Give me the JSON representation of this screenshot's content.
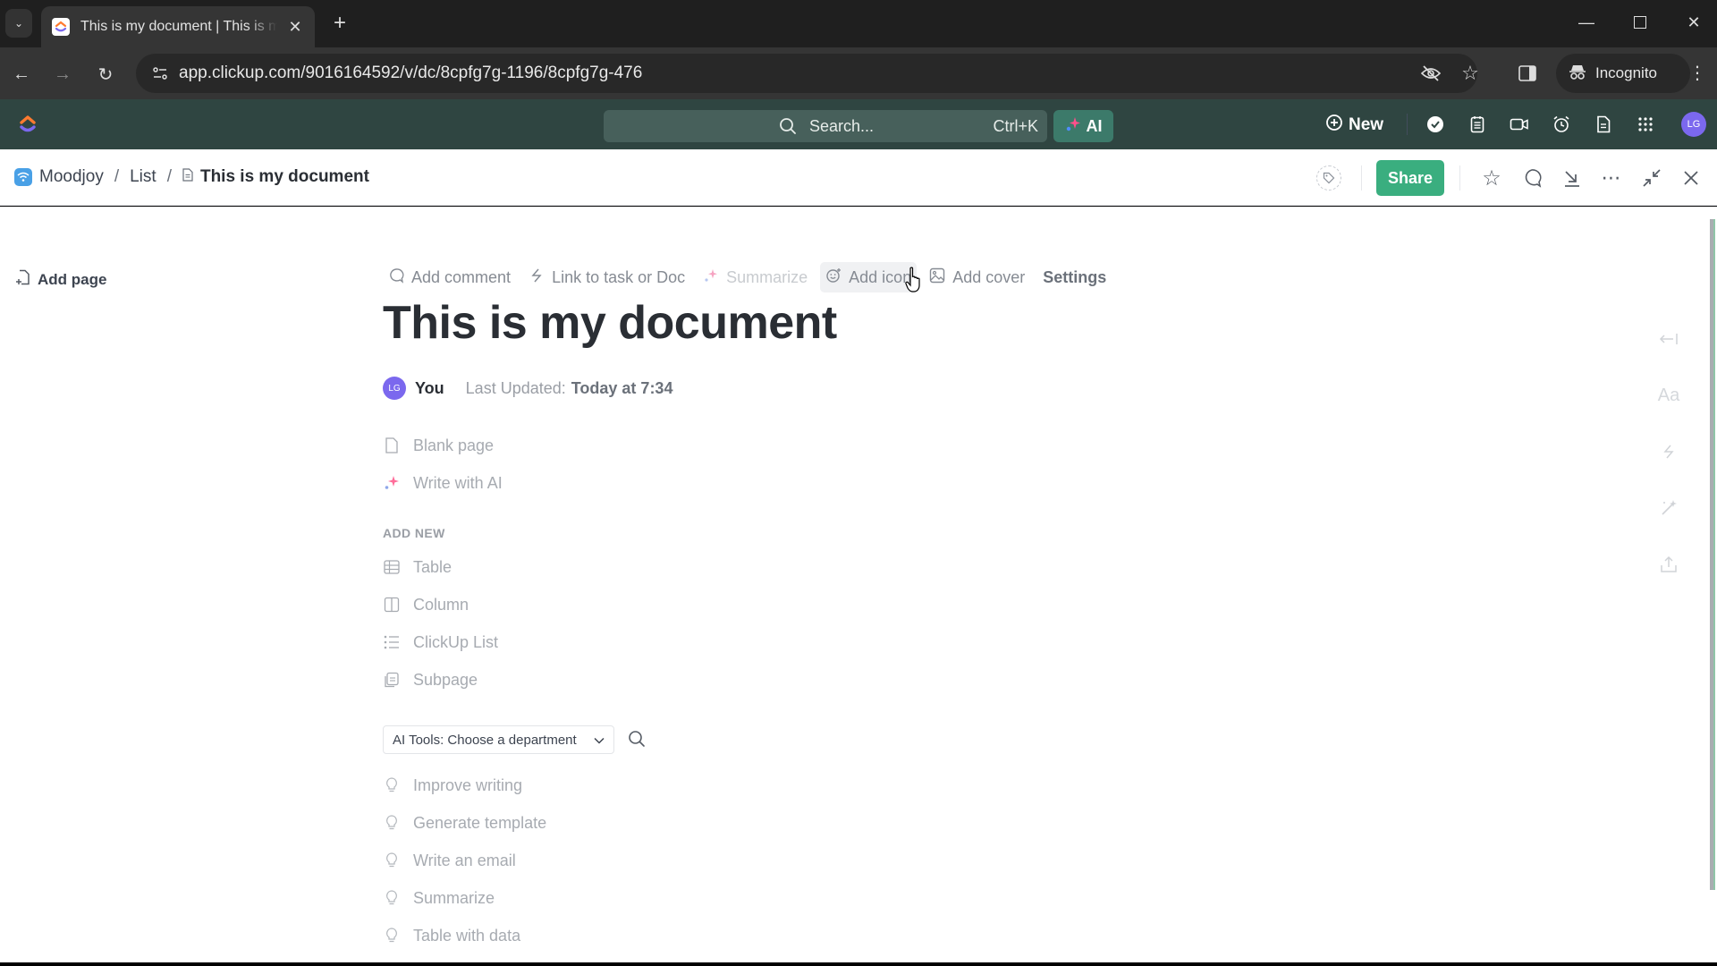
{
  "browser": {
    "tab_title": "This is my document | This is my document",
    "url": "app.clickup.com/9016164592/v/dc/8cpfg7g-1196/8cpfg7g-476",
    "incognito_label": "Incognito",
    "new_tab_label": "+",
    "tab_close": "✕"
  },
  "topbar": {
    "search_placeholder": "Search...",
    "search_shortcut": "Ctrl+K",
    "ai_label": "AI",
    "new_label": "New",
    "avatar_initials": "LG",
    "icons": [
      "check-circle-icon",
      "notepad-icon",
      "video-icon",
      "alarm-clock-icon",
      "document-icon",
      "apps-grid-icon"
    ]
  },
  "breadcrumb": {
    "space": "Moodjoy",
    "list": "List",
    "document": "This is my document",
    "separator": "/"
  },
  "header_actions": {
    "share_label": "Share",
    "brand_color": "#3aae7f"
  },
  "sidebar": {
    "add_page_label": "Add page"
  },
  "doc_toolbar": {
    "add_comment": "Add comment",
    "link_task": "Link to task or Doc",
    "summarize": "Summarize",
    "add_icon": "Add icon",
    "add_cover": "Add cover",
    "settings": "Settings"
  },
  "document": {
    "title": "This is my document",
    "author_initials": "LG",
    "author": "You",
    "last_updated_label": "Last Updated:",
    "last_updated_value": "Today at 7:34"
  },
  "start_options": [
    {
      "label": "Blank page",
      "icon": "blank-page-icon"
    },
    {
      "label": "Write with AI",
      "icon": "sparkle-icon"
    }
  ],
  "add_new": {
    "label": "ADD NEW",
    "items": [
      {
        "label": "Table",
        "icon": "table-icon"
      },
      {
        "label": "Column",
        "icon": "column-icon"
      },
      {
        "label": "ClickUp List",
        "icon": "list-icon"
      },
      {
        "label": "Subpage",
        "icon": "subpage-icon"
      }
    ]
  },
  "ai_tools": {
    "select_label": "AI Tools: Choose a department",
    "items": [
      {
        "label": "Improve writing"
      },
      {
        "label": "Generate template"
      },
      {
        "label": "Write an email"
      },
      {
        "label": "Summarize"
      },
      {
        "label": "Table with data"
      }
    ]
  },
  "right_rail": {
    "font_label": "Aa"
  }
}
